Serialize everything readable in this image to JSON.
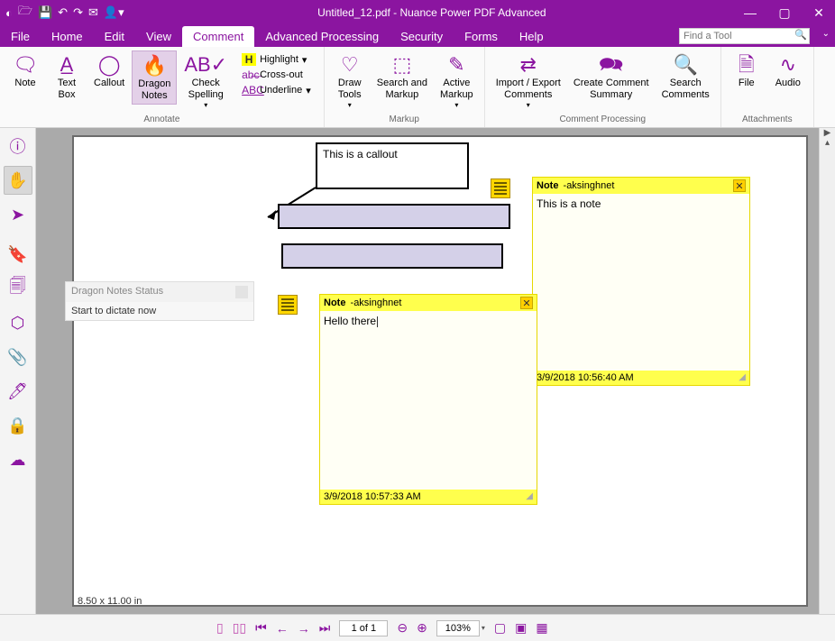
{
  "title": "Untitled_12.pdf - Nuance Power PDF Advanced",
  "menu": {
    "file": "File",
    "home": "Home",
    "edit": "Edit",
    "view": "View",
    "comment": "Comment",
    "advanced": "Advanced Processing",
    "security": "Security",
    "forms": "Forms",
    "help": "Help"
  },
  "tool_search_placeholder": "Find a Tool",
  "ribbon": {
    "annotate": {
      "label": "Annotate",
      "note": "Note",
      "textbox": "Text\nBox",
      "callout": "Callout",
      "dragon": "Dragon\nNotes",
      "spelling": "Check\nSpelling",
      "highlight": "Highlight",
      "crossout": "Cross-out",
      "underline": "Underline"
    },
    "markup": {
      "label": "Markup",
      "draw": "Draw\nTools",
      "search": "Search and\nMarkup",
      "active": "Active\nMarkup"
    },
    "processing": {
      "label": "Comment Processing",
      "import": "Import / Export\nComments",
      "summary": "Create Comment\nSummary",
      "searchc": "Search\nComments"
    },
    "attachments": {
      "label": "Attachments",
      "file": "File",
      "audio": "Audio"
    }
  },
  "dragon": {
    "title": "Dragon Notes Status",
    "body": "Start to dictate now"
  },
  "callout_text": "This is a callout",
  "note1": {
    "header_label": "Note",
    "author": "aksinghnet",
    "body": "This is a note",
    "ts": "3/9/2018 10:56:40 AM"
  },
  "note2": {
    "header_label": "Note",
    "author": "aksinghnet",
    "body": "Hello there",
    "ts": "3/9/2018 10:57:33 AM"
  },
  "page_size": "8.50 x 11.00 in",
  "status": {
    "page": "1 of 1",
    "zoom": "103%"
  }
}
